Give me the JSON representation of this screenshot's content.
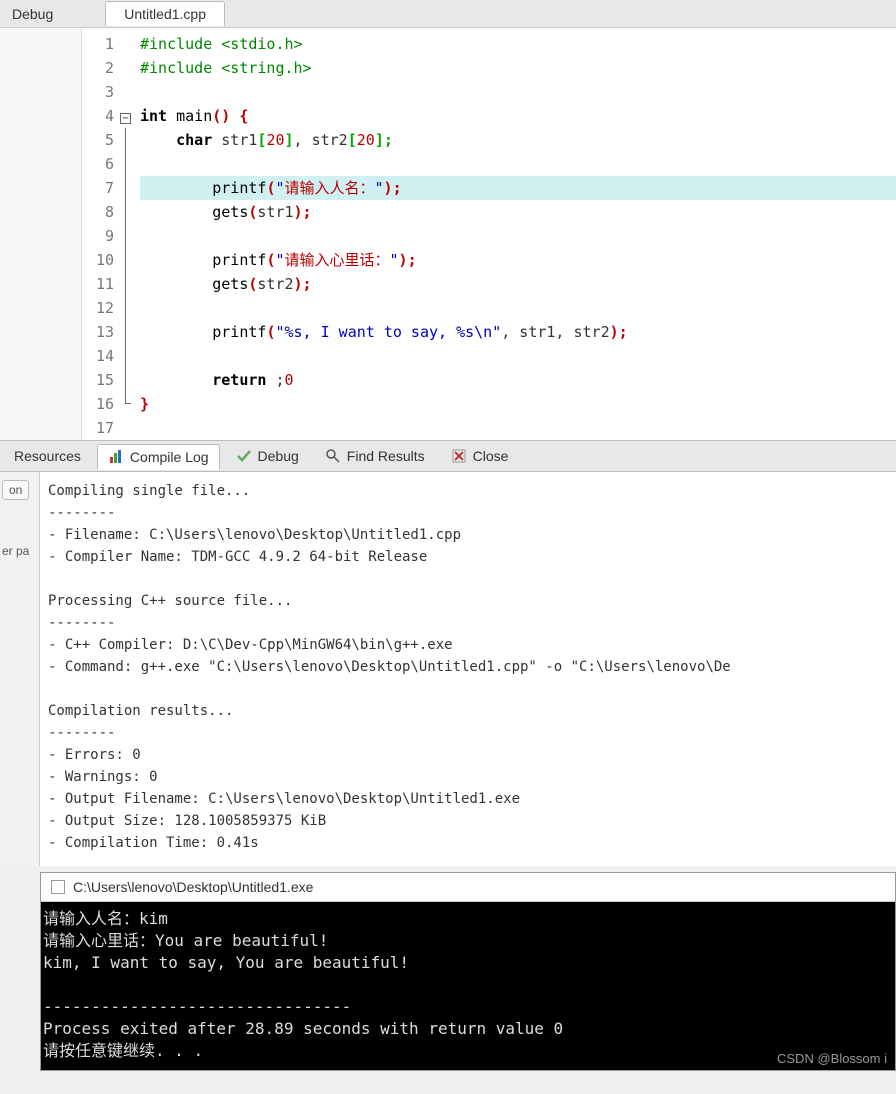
{
  "top": {
    "left_tab": "Debug",
    "file_tab": "Untitled1.cpp"
  },
  "code": {
    "lines": [
      {
        "n": "1",
        "pre": "#include <stdio.h>"
      },
      {
        "n": "2",
        "pre": "#include <string.h>"
      },
      {
        "n": "3"
      },
      {
        "n": "4",
        "kw": "int ",
        "fn": "main",
        "par": "() ",
        "brace": "{",
        "fold": true
      },
      {
        "n": "5",
        "indent": "    ",
        "kw": "char ",
        "t1": "str1",
        "bracket1": "[",
        "num1": "20",
        "bracket2": "]",
        "t2": ", str2",
        "bracket3": "[",
        "num2": "20",
        "bracket4": "];"
      },
      {
        "n": "6"
      },
      {
        "n": "7",
        "indent": "        ",
        "fn": "printf",
        "par1": "(",
        "q1": "\"",
        "han": "请输入人名：",
        "q2": "\"",
        "par2": ");",
        "hl": true
      },
      {
        "n": "8",
        "indent": "        ",
        "fn": "gets",
        "par1": "(",
        "arg": "str1",
        "par2": ");"
      },
      {
        "n": "9"
      },
      {
        "n": "10",
        "indent": "        ",
        "fn": "printf",
        "par1": "(",
        "q1": "\"",
        "han": "请输入心里话：",
        "q2": "\"",
        "par2": ");"
      },
      {
        "n": "11",
        "indent": "        ",
        "fn": "gets",
        "par1": "(",
        "arg": "str2",
        "par2": ");"
      },
      {
        "n": "12"
      },
      {
        "n": "13",
        "indent": "        ",
        "fn": "printf",
        "par1": "(",
        "str": "\"%s, I want to say, %s\\n\"",
        "t": ", str1, str2",
        "par2": ");"
      },
      {
        "n": "14"
      },
      {
        "n": "15",
        "indent": "        ",
        "kw": "return ",
        "num": "0",
        "t": ";"
      },
      {
        "n": "16",
        "brace": "}",
        "foldend": true
      },
      {
        "n": "17"
      }
    ]
  },
  "panel_tabs": {
    "resources": "Resources",
    "compile_log": "Compile Log",
    "debug": "Debug",
    "find": "Find Results",
    "close": "Close"
  },
  "left": {
    "l1": "on",
    "l2": "er pa"
  },
  "compile_output": "Compiling single file...\n--------\n- Filename: C:\\Users\\lenovo\\Desktop\\Untitled1.cpp\n- Compiler Name: TDM-GCC 4.9.2 64-bit Release\n\nProcessing C++ source file...\n--------\n- C++ Compiler: D:\\C\\Dev-Cpp\\MinGW64\\bin\\g++.exe\n- Command: g++.exe \"C:\\Users\\lenovo\\Desktop\\Untitled1.cpp\" -o \"C:\\Users\\lenovo\\De\n\nCompilation results...\n--------\n- Errors: 0\n- Warnings: 0\n- Output Filename: C:\\Users\\lenovo\\Desktop\\Untitled1.exe\n- Output Size: 128.1005859375 KiB\n- Compilation Time: 0.41s",
  "console": {
    "title": "C:\\Users\\lenovo\\Desktop\\Untitled1.exe",
    "body": "请输入人名：kim\n请输入心里话：You are beautiful!\nkim, I want to say, You are beautiful!\n\n--------------------------------\nProcess exited after 28.89 seconds with return value 0\n请按任意键继续. . ."
  },
  "watermark": "CSDN @Blossom i"
}
